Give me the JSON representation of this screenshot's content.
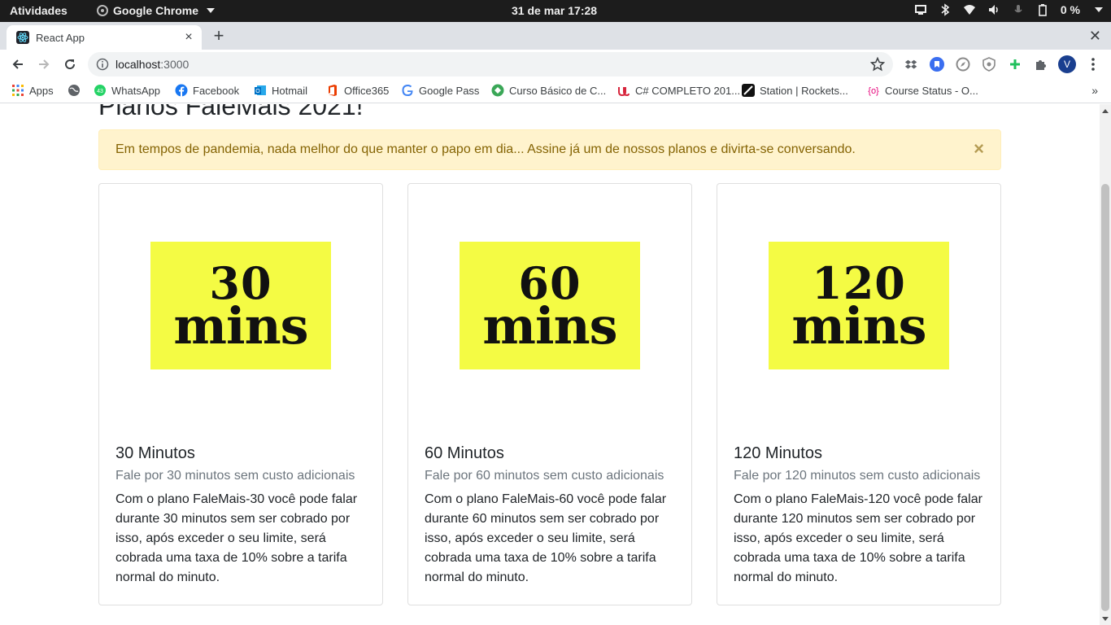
{
  "system_bar": {
    "activities": "Atividades",
    "app_name": "Google Chrome",
    "clock": "31 de mar  17:28",
    "battery": "0 %"
  },
  "browser": {
    "tab_title": "React App",
    "url_host": "localhost",
    "url_port": ":3000",
    "profile_initial": "V"
  },
  "bookmarks": [
    {
      "label": "Apps",
      "color": "#ea4335"
    },
    {
      "label": "",
      "color": "#5f6368"
    },
    {
      "label": "WhatsApp",
      "color": "#25d366"
    },
    {
      "label": "Facebook",
      "color": "#1877f2"
    },
    {
      "label": "Hotmail",
      "color": "#0072c6"
    },
    {
      "label": "Office365",
      "color": "#eb3c00"
    },
    {
      "label": "Google Pass",
      "color": "#4285f4"
    },
    {
      "label": "Curso Básico de C...",
      "color": "#3aa757"
    },
    {
      "label": "C# COMPLETO 201...",
      "color": "#d7263d"
    },
    {
      "label": "Station | Rockets...",
      "color": "#111111"
    },
    {
      "label": "Course Status - O...",
      "color": "#e6007a"
    }
  ],
  "page": {
    "title": "Planos FaleMais 2021!",
    "alert": "Em tempos de pandemia, nada melhor do que manter o papo em dia... Assine já um de nossos planos e divirta-se conversando.",
    "alert_close": "×"
  },
  "cards": [
    {
      "img_number": "30",
      "img_unit": "mins",
      "title": "30 Minutos",
      "subtitle": "Fale por 30 minutos sem custo adicionais",
      "text": "Com o plano FaleMais-30 você pode falar durante 30 minutos sem ser cobrado por isso, após exceder o seu limite, será cobrada uma taxa de 10% sobre a tarifa normal do minuto."
    },
    {
      "img_number": "60",
      "img_unit": "mins",
      "title": "60 Minutos",
      "subtitle": "Fale por 60 minutos sem custo adicionais",
      "text": "Com o plano FaleMais-60 você pode falar durante 60 minutos sem ser cobrado por isso, após exceder o seu limite, será cobrada uma taxa de 10% sobre a tarifa normal do minuto."
    },
    {
      "img_number": "120",
      "img_unit": "mins",
      "title": "120 Minutos",
      "subtitle": "Fale por 120 minutos sem custo adicionais",
      "text": "Com o plano FaleMais-120 você pode falar durante 120 minutos sem ser cobrado por isso, após exceder o seu limite, será cobrada uma taxa de 10% sobre a tarifa normal do minuto."
    }
  ]
}
